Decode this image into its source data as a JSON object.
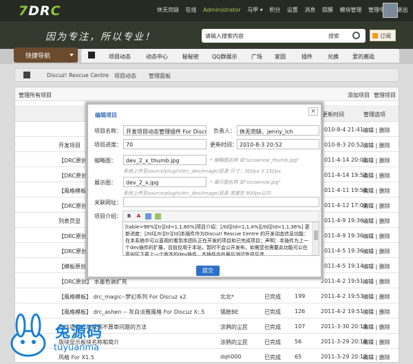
{
  "topbar": {
    "logo_main": "DR",
    "logo_accent": "C",
    "logo_prefix": "7",
    "user_links": [
      "休无完缺",
      "在线",
      "Administrator",
      "马甲 ▾",
      "积分",
      "设置",
      "消息",
      "提醒",
      "模块管理",
      "管理中心",
      "退出"
    ]
  },
  "banner": {
    "slogan": "因为专注，所以专业！",
    "search_placeholder": "请输入搜索内容",
    "search_type": "搜索",
    "subscribe_label": "订阅"
  },
  "nav": {
    "quick_nav": "快捷导航",
    "tabs": [
      "项目动态",
      "动态中心",
      "秘秘密",
      "QQ群展示",
      "广场",
      "家园",
      "插件",
      "兑换",
      "爱的邂逅"
    ]
  },
  "breadcrumb": [
    "Discuz! Rescue Centre",
    "项目动态",
    "管理面板"
  ],
  "panel": {
    "title": "管理所有项目",
    "actions": [
      "添加项目",
      "管理项目"
    ],
    "col_update": "更新时间",
    "col_ops": "管理选项"
  },
  "rows": [
    {
      "name": "",
      "author": "",
      "status": "",
      "count": "",
      "date": "2010-8-4 21:41",
      "ops": "编辑 | 删除"
    },
    {
      "name": "开发项目",
      "author": "",
      "status": "",
      "count": "",
      "date": "2010-8-3 20:52",
      "ops": "编辑 | 删除"
    },
    {
      "name": "【DRC原创】",
      "author": "",
      "status": "",
      "count": "",
      "date": "2011-4-14 20:01",
      "ops": "编辑 | 删除"
    },
    {
      "name": "【DRC原创】 涂鸦网",
      "author": "",
      "status": "",
      "count": "",
      "date": "2011-4-14 19:52",
      "ops": "编辑 | 删除"
    },
    {
      "name": "【風格模板】",
      "author": "",
      "status": "",
      "count": "",
      "date": "2011-4-11 19:58",
      "ops": "编辑 | 删除"
    },
    {
      "name": "【DRC原创】 涂鸦网",
      "author": "",
      "status": "",
      "count": "",
      "date": "2011-4-12 17:03",
      "ops": "编辑 | 删除"
    },
    {
      "name": "列表页显",
      "author": "",
      "status": "",
      "count": "",
      "date": "2011-4-9 19:36",
      "ops": "编辑 | 删除"
    },
    {
      "name": "【DRC原创】",
      "author": "",
      "status": "",
      "count": "",
      "date": "2011-4-9 19:36",
      "ops": "编辑 | 删除"
    },
    {
      "name": "【DRC原创】 涂鸦网",
      "author": "",
      "status": "",
      "count": "",
      "date": "2011-4-5 19:36",
      "ops": "编辑 | 删除"
    },
    {
      "name": "【模板原创】",
      "author": "",
      "status": "",
      "count": "",
      "date": "2011-4-5 19:14",
      "ops": "编辑 | 删除"
    },
    {
      "name": "【DRC原创】 水墨色调扩充",
      "author": "",
      "status": "",
      "count": "",
      "date": "2011-4-2 19:51",
      "ops": "编辑 | 删除"
    },
    {
      "name": "【風格模板】 drc_magic--梦幻系列 For Discuz x2",
      "author": "北北*",
      "status": "已完成",
      "count": "199",
      "date": "2011-4-2 19:53",
      "ops": "编辑 | 删除"
    },
    {
      "name": "【風格模板】 drc_ashen -- 灰白淡雅風格 For Discuz X:.5",
      "author": "锡胀BE",
      "status": "已完成",
      "count": "126",
      "date": "2011-4-2 19:51",
      "ops": "编辑 | 删除"
    },
    {
      "name": "的访问模式的瓶颈不算审问题的方法",
      "author": "涂鸦的尘民",
      "status": "已完成",
      "count": "107",
      "date": "2011-3-30 20:13",
      "ops": "编辑 | 删除"
    },
    {
      "name": "版块显示板块名称和简介",
      "author": "涂鸦的尘民",
      "status": "已完成",
      "count": "56",
      "date": "2011-3-29 20:18",
      "ops": "编辑 | 删除"
    },
    {
      "name": "风格 For X1.5",
      "author": "dqh000",
      "status": "已完成",
      "count": "65",
      "date": "2011-3-29 20:12",
      "ops": "编辑 | 删除"
    }
  ],
  "dialog": {
    "title": "编辑项目",
    "close": "×",
    "name_label": "项目名称：",
    "name_value": "开发项目动态管理插件 For Discuz!X",
    "owner_label": "负责人：",
    "owner_value": "休无完缺、jenny_lch",
    "progress_label": "项目进度：",
    "progress_value": "70",
    "update_label": "更新时间：",
    "update_value": "2010-8-3 20:52",
    "thumb_label": "缩略图：",
    "thumb_value": "dev_2_x_thumb.jpg",
    "thumb_hint": "* 缩略图名称 如\"sicownow_thumb.jpg\"",
    "thumb_hint2": "系统上传至source/plugin/drc_dev/image/目录 尺寸：300px X 150px",
    "show_label": "展示图：",
    "show_value": "dev_2_x.jpg",
    "show_hint": "* 展示图名称 如\"sicownow.jpg\"",
    "show_hint2": "系统上传至source/plugin/drc_dev/image/目录 宽度在 900px以内",
    "url_label": "关联网址：",
    "url_value": "",
    "intro_label": "项目介绍：",
    "intro_text": "[table=98%][tr][td=1,1,60%]项目介绍：[/td][td=1,1,4%][/td][td=1,1,36%] 更新进度：[/td][/tr][tr][td]本插件作为Discuz! Rescue Centre 的开发动态信息功能：在本系统中可以直观的看到本团队正在开发的项目和已完成项目；声明：本插件为上一个dev插件的扩展，目前仅用于本站，暂时不会公开发布，如需您也需要此功能可以在原创区下载上一个版本的dev插件，本插件会在最后测试完成后选",
    "submit": "提交"
  },
  "watermark": {
    "cn": "兔源码",
    "en": "tuyuanma"
  }
}
